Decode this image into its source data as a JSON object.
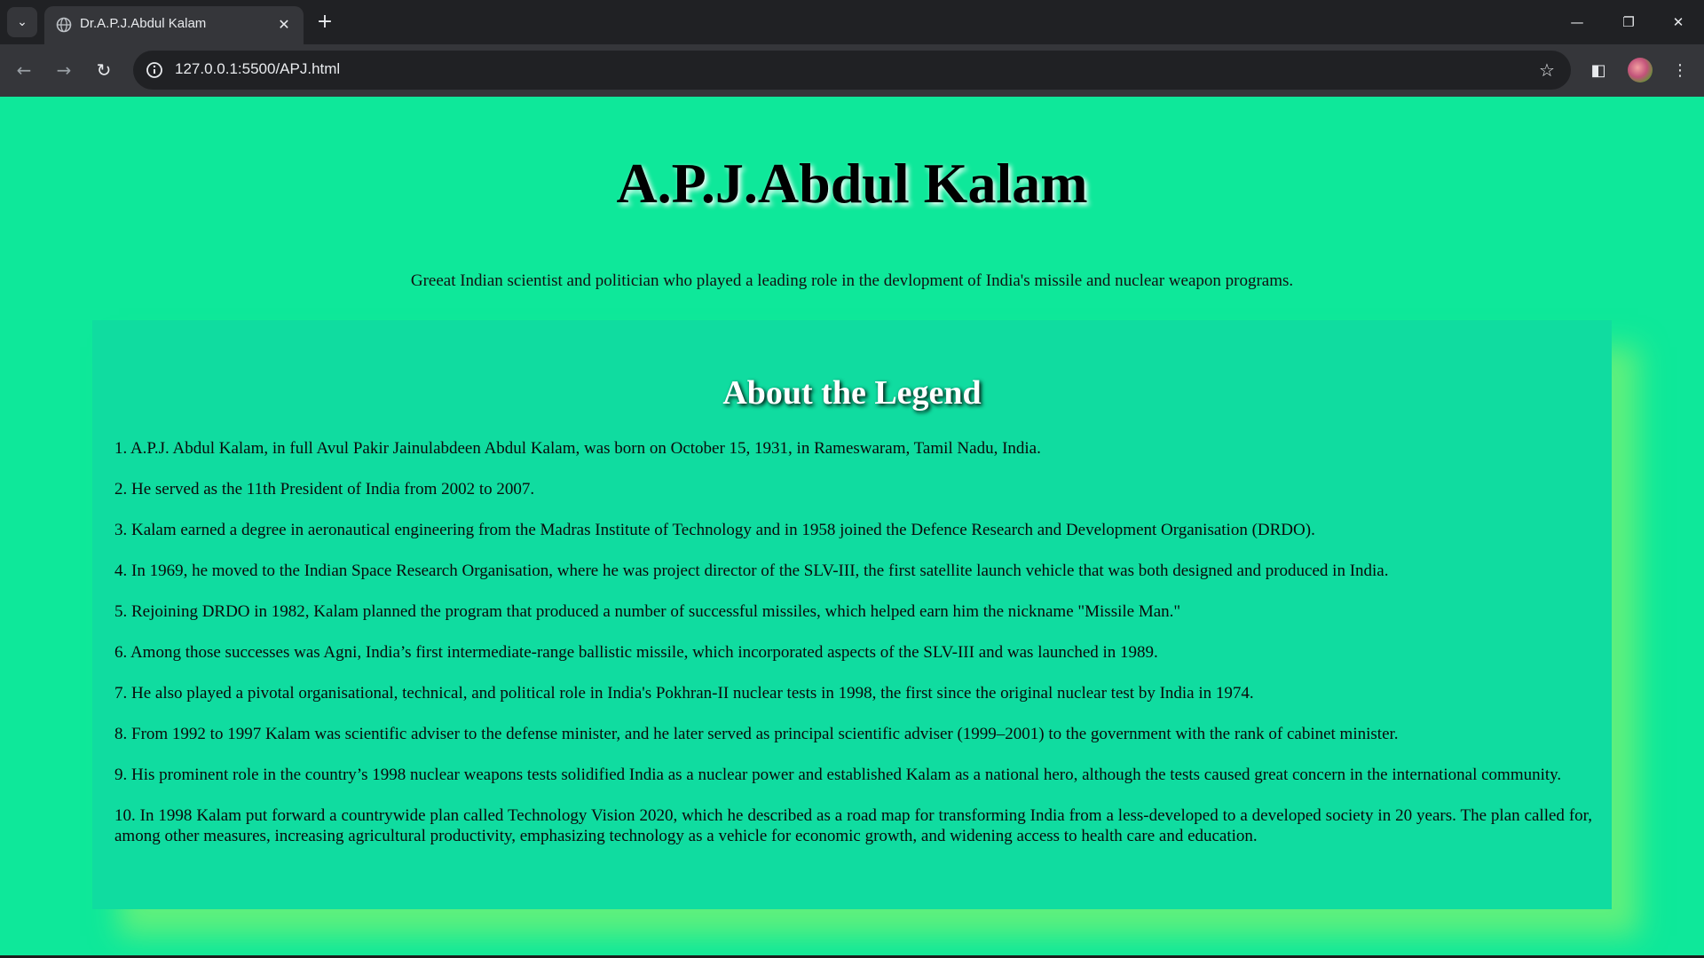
{
  "browser": {
    "tab_title": "Dr.A.P.J.Abdul Kalam",
    "url": "127.0.0.1:5500/APJ.html",
    "icons": {
      "tab_search": "chevron-down-icon",
      "favicon": "globe-icon",
      "tab_close": "close-icon",
      "new_tab": "plus-icon",
      "minimize": "minimize-icon",
      "restore": "restore-icon",
      "close_window": "close-icon",
      "back": "back-arrow-icon",
      "forward": "forward-arrow-icon",
      "reload": "reload-icon",
      "site_info": "info-icon",
      "bookmark": "star-icon",
      "side_panel": "side-panel-icon",
      "menu": "kebab-menu-icon"
    }
  },
  "page": {
    "title": "A.P.J.Abdul Kalam",
    "tagline": "Greeat Indian scientist and politician who played a leading role in the devlopment of India's missile and nuclear weapon programs.",
    "about": {
      "heading": "About the Legend",
      "facts": [
        "1. A.P.J. Abdul Kalam, in full Avul Pakir Jainulabdeen Abdul Kalam, was born on October 15, 1931, in Rameswaram, Tamil Nadu, India.",
        "2. He served as the 11th President of India from 2002 to 2007.",
        "3. Kalam earned a degree in aeronautical engineering from the Madras Institute of Technology and in 1958 joined the Defence Research and Development Organisation (DRDO).",
        "4. In 1969, he moved to the Indian Space Research Organisation, where he was project director of the SLV-III, the first satellite launch vehicle that was both designed and produced in India.",
        "5. Rejoining DRDO in 1982, Kalam planned the program that produced a number of successful missiles, which helped earn him the nickname \"Missile Man.\"",
        "6. Among those successes was Agni, India’s first intermediate-range ballistic missile, which incorporated aspects of the SLV-III and was launched in 1989.",
        "7. He also played a pivotal organisational, technical, and political role in India's Pokhran-II nuclear tests in 1998, the first since the original nuclear test by India in 1974.",
        "8. From 1992 to 1997 Kalam was scientific adviser to the defense minister, and he later served as principal scientific adviser (1999–2001) to the government with the rank of cabinet minister.",
        "9. His prominent role in the country’s 1998 nuclear weapons tests solidified India as a nuclear power and established Kalam as a national hero, although the tests caused great concern in the international community.",
        "10. In 1998 Kalam put forward a countrywide plan called Technology Vision 2020, which he described as a road map for transforming India from a less-developed to a developed society in 20 years. The plan called for, among other measures, increasing agricultural productivity, emphasizing technology as a vehicle for economic growth, and widening access to health care and education."
      ]
    }
  },
  "colors": {
    "page_background": "#0ee89a",
    "panel_background": "#10dca0",
    "panel_shadow": "#5ff07d",
    "chrome_dark": "#202124",
    "chrome_toolbar": "#35363a"
  }
}
